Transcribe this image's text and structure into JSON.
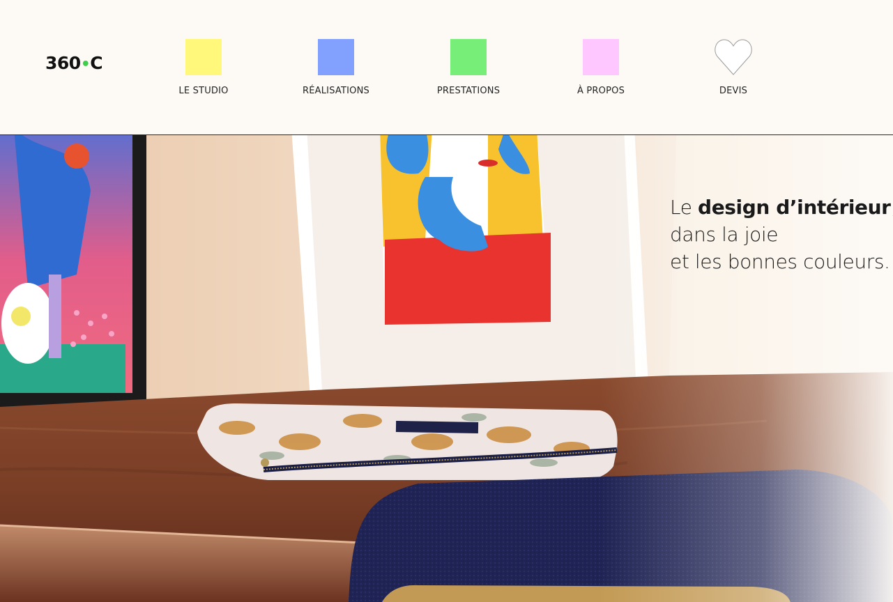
{
  "brand": {
    "logo_left": "360",
    "logo_dot": "•",
    "logo_right": "C"
  },
  "nav": {
    "items": [
      {
        "label": "LE STUDIO",
        "color": "#fff87a"
      },
      {
        "label": "RÉALISATIONS",
        "color": "#82a1ff"
      },
      {
        "label": "PRESTATIONS",
        "color": "#77ee77"
      },
      {
        "label": "À PROPOS",
        "color": "#ffc7ff"
      },
      {
        "label": "DEVIS",
        "icon": "heart-icon"
      }
    ]
  },
  "hero": {
    "tagline": {
      "line1_pre": "Le ",
      "line1_bold": "design d’intérieur",
      "line1_post": ",",
      "line2": "dans la joie",
      "line3": "et les bonnes couleurs."
    }
  }
}
